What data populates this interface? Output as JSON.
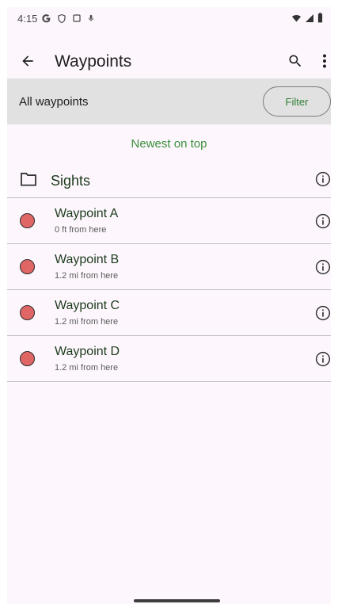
{
  "status_bar": {
    "time": "4:15",
    "icons_left": [
      "google-icon",
      "vpn-shield-icon",
      "screen-icon",
      "mic-icon"
    ],
    "icons_right": [
      "wifi-icon",
      "signal-icon",
      "battery-icon"
    ]
  },
  "app_bar": {
    "title": "Waypoints"
  },
  "filter_bar": {
    "label": "All waypoints",
    "filter_button": "Filter"
  },
  "sort_label": "Newest on top",
  "group": {
    "label": "Sights"
  },
  "waypoints": [
    {
      "name": "Waypoint A",
      "distance": "0 ft from here"
    },
    {
      "name": "Waypoint B",
      "distance": "1.2 mi from here"
    },
    {
      "name": "Waypoint C",
      "distance": "1.2 mi from here"
    },
    {
      "name": "Waypoint D",
      "distance": "1.2 mi from here"
    }
  ],
  "colors": {
    "accent": "#3a8f3a",
    "waypoint_dot": "#e06666",
    "filter_bar_bg": "#e1e1e1",
    "background": "#fdf7fd"
  }
}
